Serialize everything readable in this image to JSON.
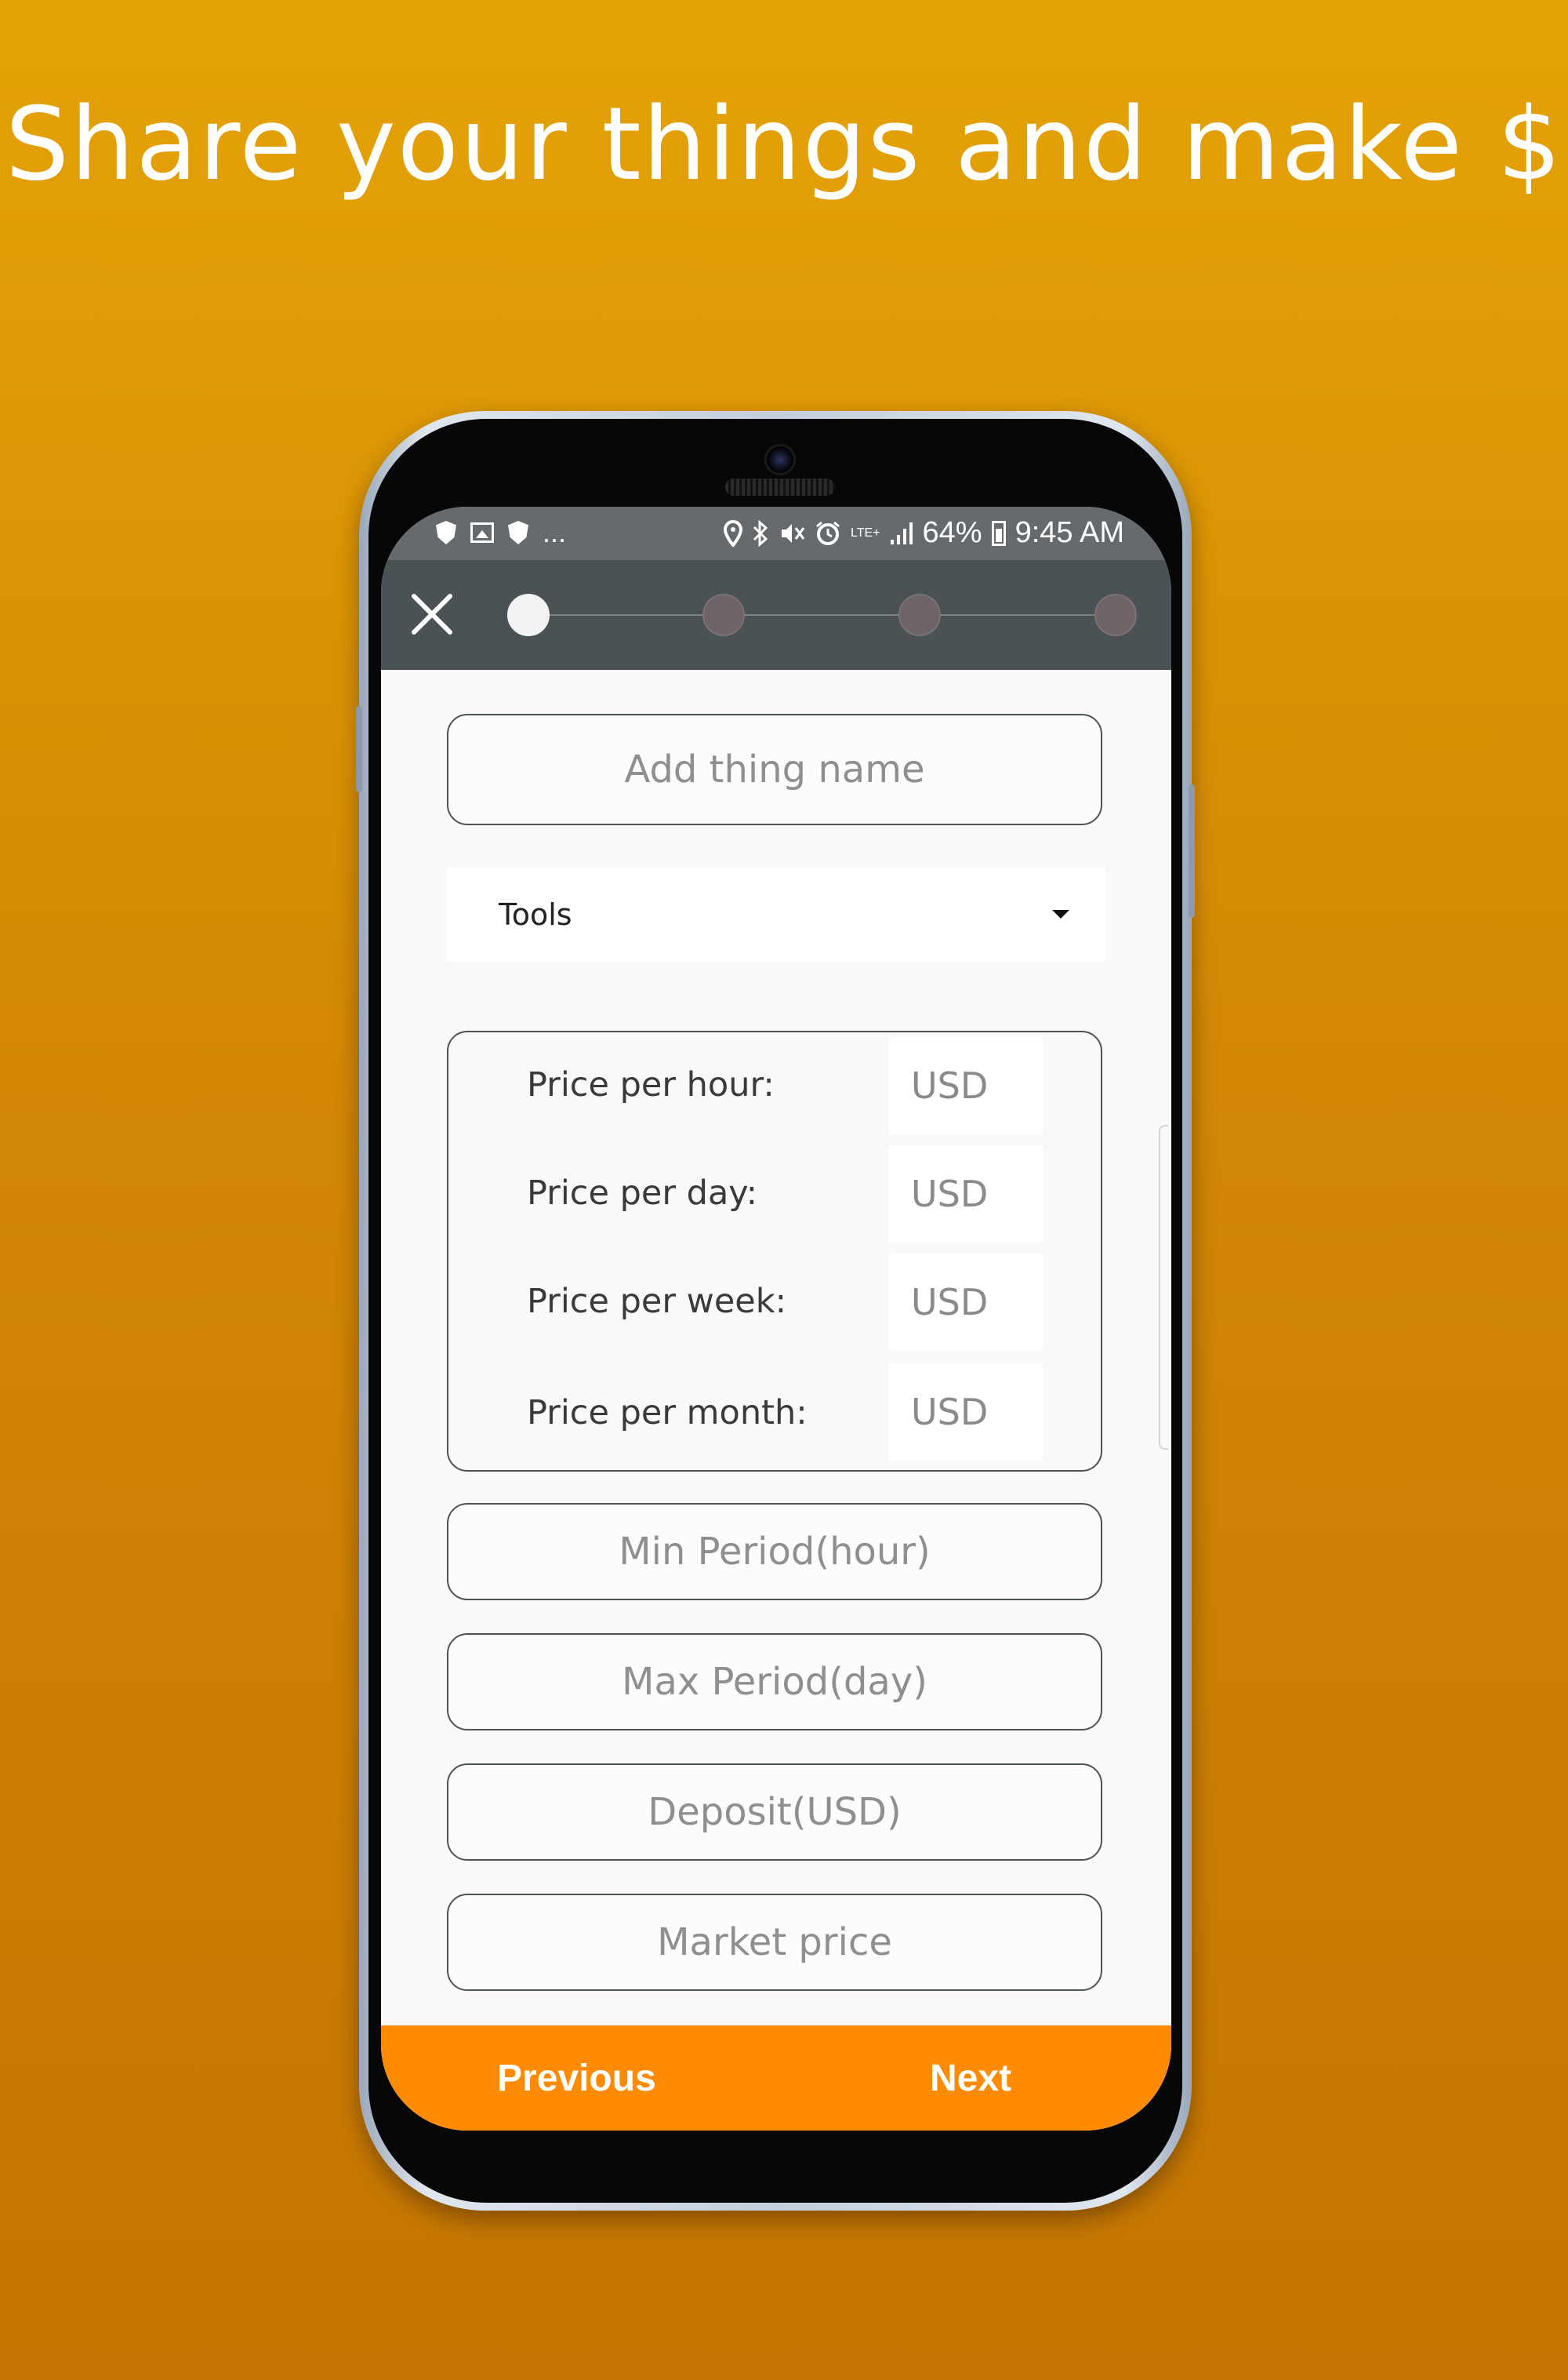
{
  "headline": "Share your things and make $",
  "status_bar": {
    "left_icons": [
      "shield-icon",
      "image-icon",
      "shield-icon"
    ],
    "overflow": "...",
    "right_icons": [
      "location-icon",
      "bluetooth-icon",
      "mute-icon",
      "alarm-icon",
      "signal-icon",
      "battery-icon"
    ],
    "network": "LTE+",
    "battery_percent": "64%",
    "time": "9:45 AM"
  },
  "toolbar": {
    "close_icon": "close-icon",
    "steps_total": 4,
    "current_step": 1
  },
  "form": {
    "name_placeholder": "Add thing name",
    "category_selected": "Tools",
    "prices": [
      {
        "label": "Price per hour:",
        "placeholder": "USD"
      },
      {
        "label": "Price per day:",
        "placeholder": "USD"
      },
      {
        "label": "Price per week:",
        "placeholder": "USD"
      },
      {
        "label": "Price per month:",
        "placeholder": "USD"
      }
    ],
    "min_period_placeholder": "Min Period(hour)",
    "max_period_placeholder": "Max Period(day)",
    "deposit_placeholder": "Deposit(USD)",
    "market_price_placeholder": "Market price"
  },
  "bottom_nav": {
    "previous_label": "Previous",
    "next_label": "Next"
  },
  "colors": {
    "background_top": "#e5a306",
    "background_bottom": "#c57503",
    "toolbar": "#4a5256",
    "status_bar": "#666a6d",
    "accent": "#fe8b03"
  }
}
